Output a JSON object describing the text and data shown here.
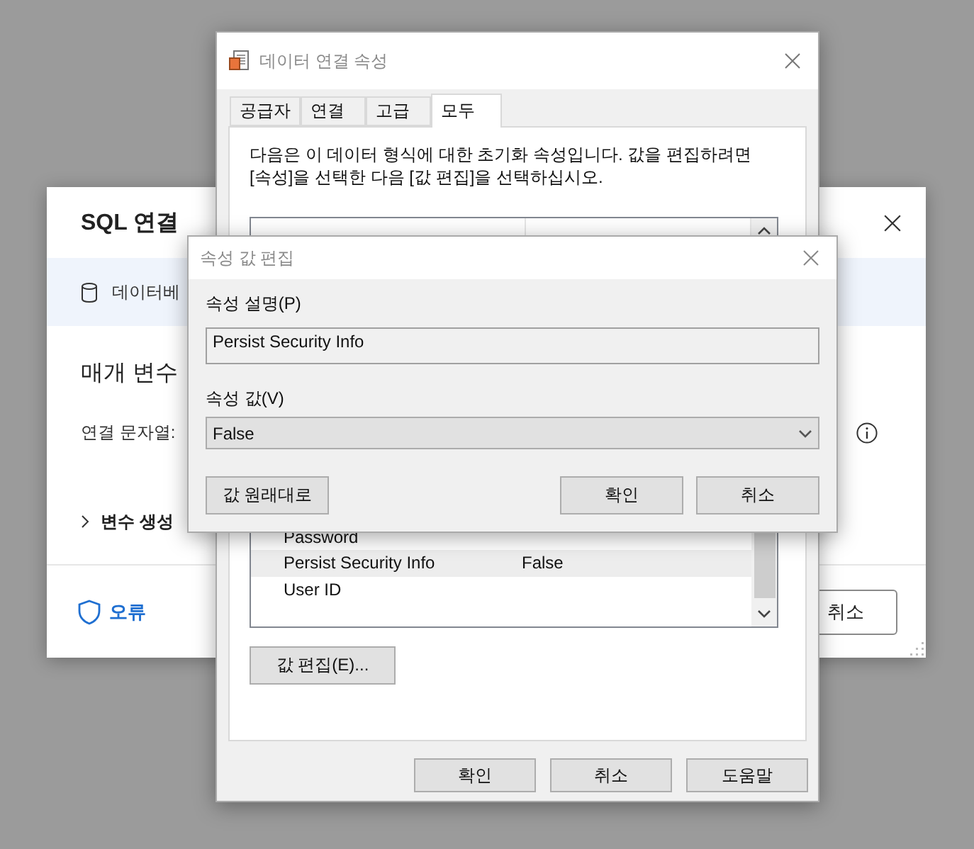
{
  "background_window": {
    "title": "SQL 연결",
    "banner": "데이터베",
    "section_title": "매개 변수",
    "field_label": "연결 문자열:",
    "expander": {
      "label": "변수 생성",
      "expanded": false
    },
    "status": "오류",
    "cancel_button": "취소"
  },
  "connection_dialog": {
    "title": "데이터 연결 속성",
    "tabs": [
      {
        "label": "공급자",
        "selected": false
      },
      {
        "label": "연결",
        "selected": false
      },
      {
        "label": "고급",
        "selected": false
      },
      {
        "label": "모두",
        "selected": true
      }
    ],
    "description": "다음은 이 데이터 형식에 대한 초기화 속성입니다. 값을 편집하려면 [속성]을 선택한 다음 [값 편집]을 선택하십시오.",
    "rows": [
      {
        "name": "Password",
        "selected": false
      },
      {
        "name": "Persist Security Info",
        "value": "False",
        "selected": true
      },
      {
        "name": "User ID",
        "selected": false
      }
    ],
    "edit_button": "값 편집(E)...",
    "buttons": [
      "확인",
      "취소",
      "도움말"
    ]
  },
  "edit_dialog": {
    "title": "속성 값 편집",
    "description_label": "속성 설명(P)",
    "description_value": "Persist Security Info",
    "value_label": "속성 값(V)",
    "value": "False",
    "reset_button": "값 원래대로",
    "buttons": [
      "확인",
      "취소"
    ]
  }
}
